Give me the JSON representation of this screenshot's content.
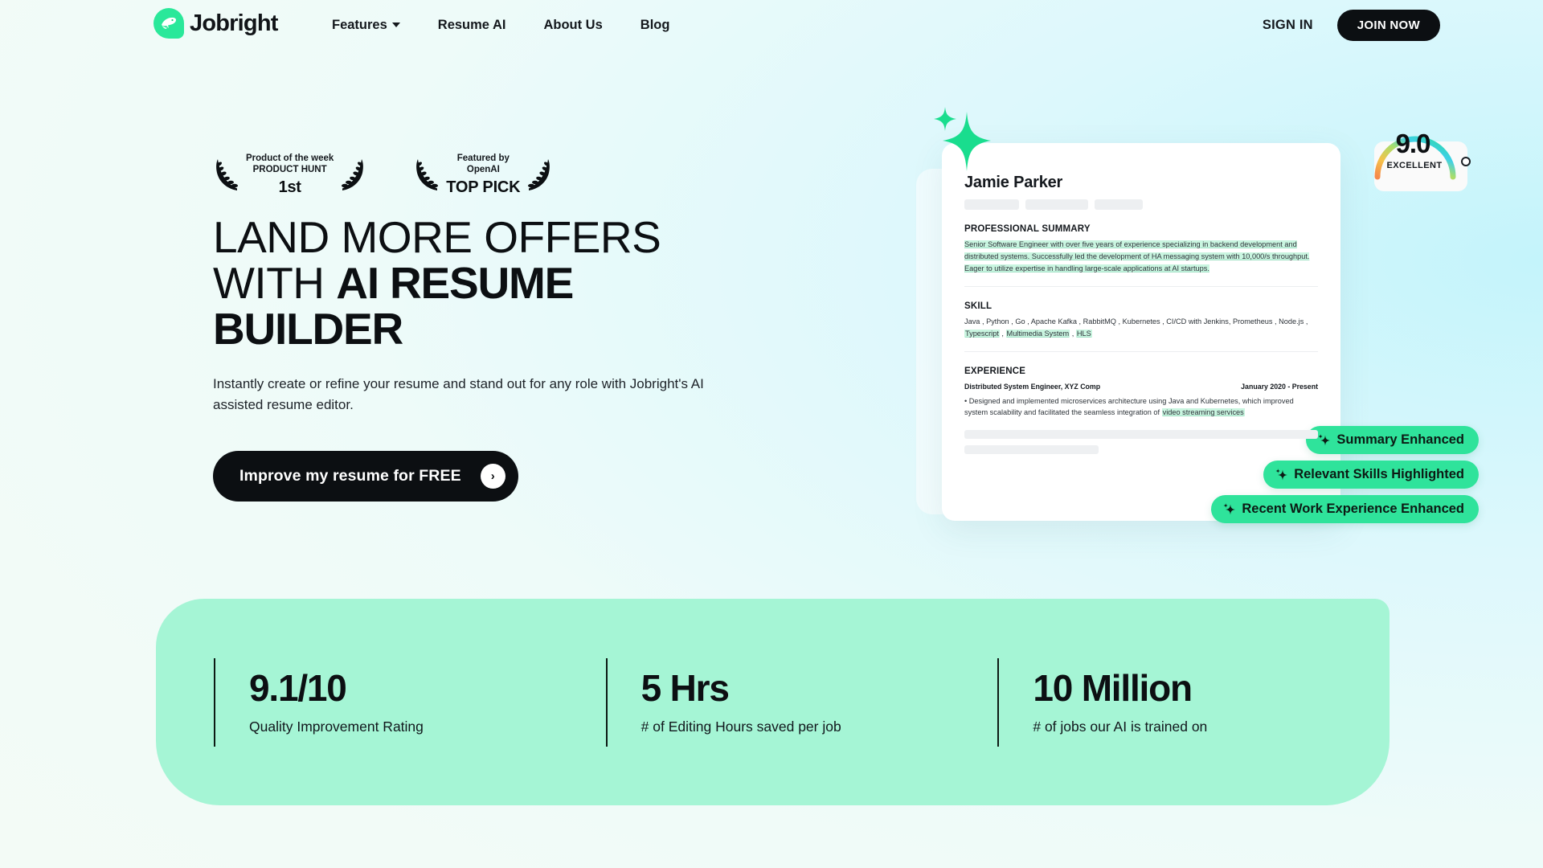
{
  "nav": {
    "brand": "Jobright",
    "brand_icon": "bird-logo-icon",
    "links": [
      {
        "label": "Features",
        "has_caret": true
      },
      {
        "label": "Resume AI",
        "has_caret": false
      },
      {
        "label": "About Us",
        "has_caret": false
      },
      {
        "label": "Blog",
        "has_caret": false
      }
    ],
    "sign_in": "SIGN IN",
    "join_now": "JOIN NOW"
  },
  "hero": {
    "awards": [
      {
        "line1": "Product of the week",
        "line2": "PRODUCT HUNT",
        "big": "1st"
      },
      {
        "line1": "Featured by",
        "line2": "OpenAI",
        "big": "TOP PICK"
      }
    ],
    "headline_part1": "LAND MORE OFFERS WITH ",
    "headline_bold": "AI RESUME BUILDER",
    "subcopy": "Instantly create or refine your resume and stand out for any role with Jobright's AI assisted resume editor.",
    "cta_label": "Improve my resume for FREE",
    "cta_arrow": "›"
  },
  "resume": {
    "name": "Jamie Parker",
    "summary_heading": "PROFESSIONAL SUMMARY",
    "summary_text": "Senior Software Engineer with over five years of experience specializing in backend development and distributed systems. Successfully led the development of HA messaging system with 10,000/s throughput. Eager to utilize expertise in handling large-scale applications at AI startups.",
    "skill_heading": "SKILL",
    "skills_plain": "Java , Python , Go , Apache Kafka , RabbitMQ , Kubernetes ,  CI/CD  with Jenkins, Prometheus , Node.js , ",
    "skills_highlighted": [
      "Typescript",
      "Multimedia System",
      "HLS"
    ],
    "experience_heading": "EXPERIENCE",
    "experience_role": "Distributed System Engineer, XYZ Comp",
    "experience_dates": "January 2020 - Present",
    "experience_bullet_pre": "• Designed and implemented microservices architecture using Java and Kubernetes, which improved system scalability and facilitated the seamless integration of ",
    "experience_bullet_hl": "video streaming services",
    "score_value": "9.0",
    "score_label": "EXCELLENT",
    "badges": [
      {
        "label": "Summary Enhanced",
        "icon": "sparkle-icon"
      },
      {
        "label": "Relevant Skills Highlighted",
        "icon": "sparkle-icon"
      },
      {
        "label": "Recent Work Experience Enhanced",
        "icon": "sparkle-icon"
      }
    ]
  },
  "stats": [
    {
      "value": "9.1/10",
      "label": "Quality Improvement Rating"
    },
    {
      "value": "5 Hrs",
      "label": "# of Editing Hours saved per job"
    },
    {
      "value": "10 Million",
      "label": "# of jobs our AI is trained on"
    }
  ],
  "colors": {
    "accent_green": "#2fe39b",
    "band_green": "#a5f5d5",
    "dark": "#0c0f12",
    "highlight": "#c9f5e0"
  }
}
